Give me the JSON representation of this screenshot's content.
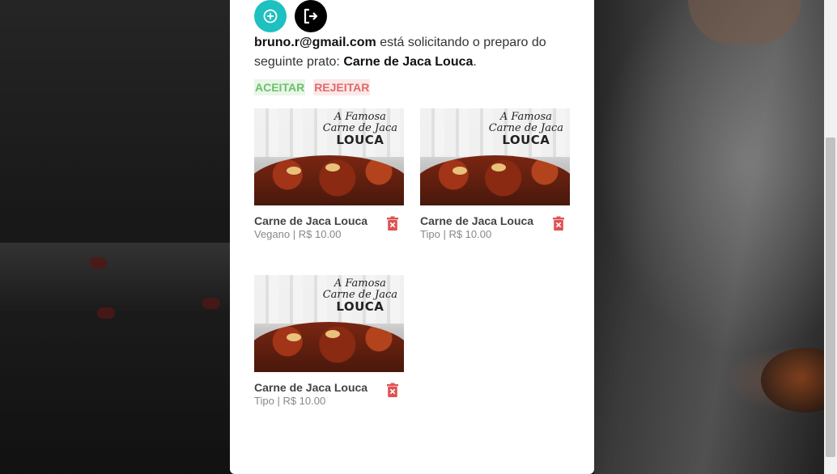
{
  "request": {
    "email": "bruno.r@gmail.com",
    "text_middle": "está solicitando o preparo do seguinte prato:",
    "dish": "Carne de Jaca Louca",
    "period": "."
  },
  "actions": {
    "accept_label": "ACEITAR",
    "reject_label": "REJEITAR"
  },
  "top_actions": {
    "add_icon": "plus-circle-icon",
    "logout_icon": "logout-icon"
  },
  "dish_image": {
    "line1": "A Famosa",
    "line2": "Carne de Jaca",
    "line3": "LOUCA"
  },
  "dishes": [
    {
      "name": "Carne de Jaca Louca",
      "type": "Vegano",
      "separator": "|",
      "price": "R$ 10.00"
    },
    {
      "name": "Carne de Jaca Louca",
      "type": "Tipo",
      "separator": "|",
      "price": "R$ 10.00"
    },
    {
      "name": "Carne de Jaca Louca",
      "type": "Tipo",
      "separator": "|",
      "price": "R$ 10.00"
    }
  ],
  "colors": {
    "add_button": "#1ec0c0",
    "logout_button": "#000000",
    "accept": "#6cc06c",
    "reject": "#e06a6a",
    "trash": "#e05252"
  }
}
